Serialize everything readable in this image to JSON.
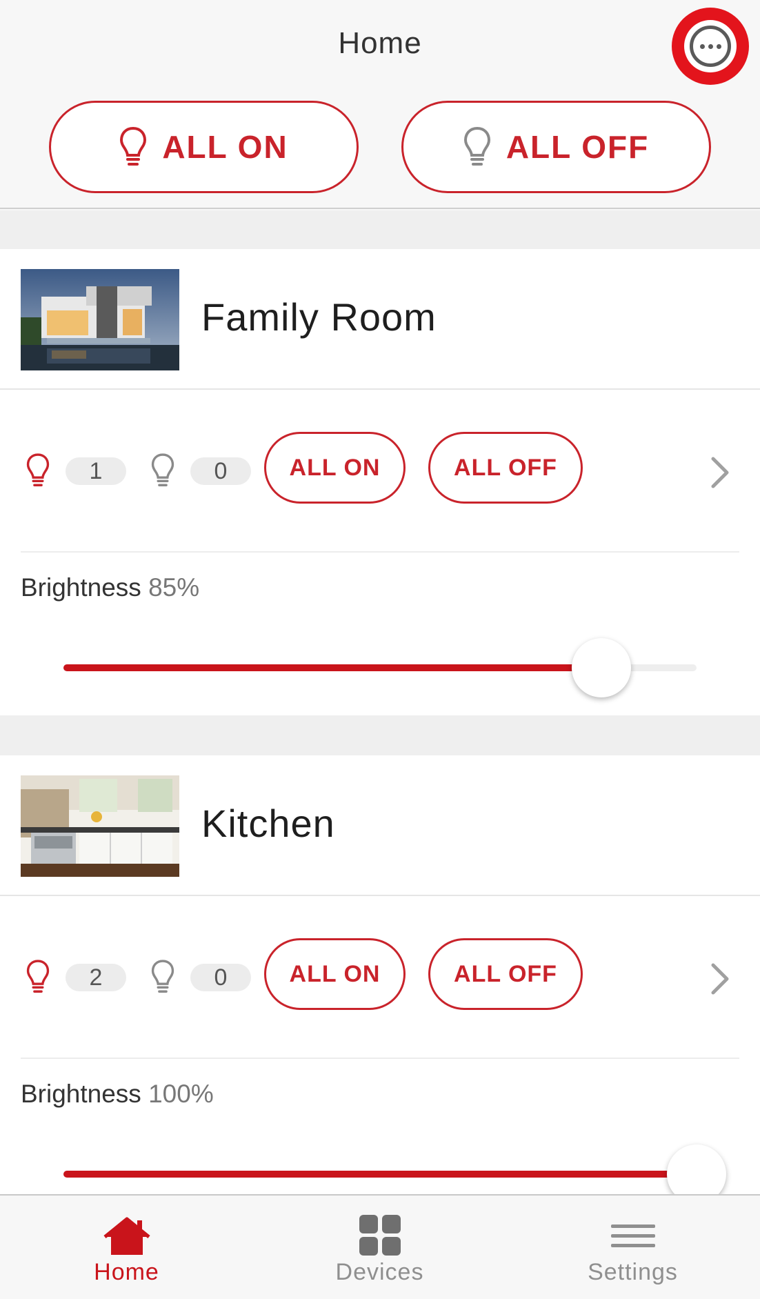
{
  "header": {
    "title": "Home",
    "more_icon": "more-horizontal-icon",
    "all_on_label": "ALL ON",
    "all_off_label": "ALL OFF"
  },
  "rooms": [
    {
      "name": "Family Room",
      "image": "modern-house-photo",
      "on_count": "1",
      "off_count": "0",
      "all_on_label": "ALL ON",
      "all_off_label": "ALL OFF",
      "brightness_label": "Brightness",
      "brightness_value": "85%",
      "brightness_level": 0.85
    },
    {
      "name": "Kitchen",
      "image": "kitchen-photo",
      "on_count": "2",
      "off_count": "0",
      "all_on_label": "ALL ON",
      "all_off_label": "ALL OFF",
      "brightness_label": "Brightness",
      "brightness_value": "100%",
      "brightness_level": 1.0
    }
  ],
  "tabs": [
    {
      "label": "Home",
      "icon": "house-icon",
      "active": true
    },
    {
      "label": "Devices",
      "icon": "grid-icon",
      "active": false
    },
    {
      "label": "Settings",
      "icon": "menu-icon",
      "active": false
    }
  ],
  "colors": {
    "accent": "#c9232b",
    "highlight_ring": "#e3141c",
    "inactive": "#8f8f8f"
  }
}
